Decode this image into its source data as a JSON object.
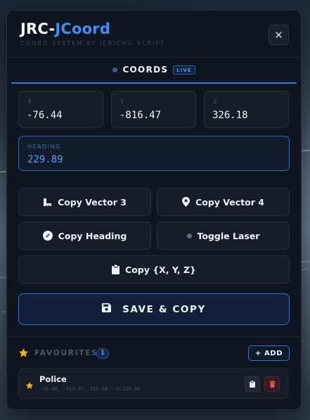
{
  "app": {
    "title_prefix": "JRC-",
    "title_accent": "JCoord",
    "subtitle": "COORD SYSTEM BY JERICHO SCRIPT",
    "close_glyph": "✕"
  },
  "tabs": [
    {
      "label": "COORDS",
      "badge": "LIVE",
      "active": true
    }
  ],
  "coords": {
    "x": {
      "label": "X",
      "value": "-76.44"
    },
    "y": {
      "label": "Y",
      "value": "-816.47"
    },
    "z": {
      "label": "Z",
      "value": "326.18"
    }
  },
  "heading": {
    "label": "HEADING",
    "value": "229.89"
  },
  "buttons": {
    "copy_vector3": {
      "label": "Copy Vector 3",
      "icon": "ruler-icon"
    },
    "copy_vector4": {
      "label": "Copy Vector 4",
      "icon": "map-pin-icon"
    },
    "copy_heading": {
      "label": "Copy Heading",
      "icon": "compass-icon"
    },
    "toggle_laser": {
      "label": "Toggle Laser",
      "icon": "dot-icon"
    },
    "copy_xyz": {
      "label": "Copy {X, Y, Z}",
      "icon": "clipboard-icon"
    },
    "save_copy": {
      "label": "SAVE & COPY",
      "icon": "save-icon"
    }
  },
  "favourites": {
    "title": "FAVOURITES",
    "count": "1",
    "add_label": "+ ADD",
    "items": [
      {
        "name": "Police",
        "meta": "-76.44, -816.47, 326.18 · H:229.89"
      }
    ]
  },
  "colors": {
    "accent": "#3d8ef7",
    "panel_bg": "#0f151e",
    "star": "#f5b800",
    "danger": "#e05a66"
  }
}
